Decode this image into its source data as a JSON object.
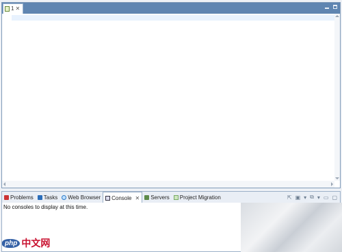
{
  "editor": {
    "tab_title": "1",
    "tab_close": "✕",
    "minimize_glyph": "",
    "maximize_glyph": ""
  },
  "views": {
    "tabs": [
      {
        "label": "Problems",
        "icon": "problems-icon"
      },
      {
        "label": "Tasks",
        "icon": "tasks-icon"
      },
      {
        "label": "Web Browser",
        "icon": "web-browser-icon"
      },
      {
        "label": "Console",
        "icon": "console-icon",
        "active": true,
        "close": "✕"
      },
      {
        "label": "Servers",
        "icon": "servers-icon"
      },
      {
        "label": "Project Migration",
        "icon": "project-migration-icon"
      }
    ],
    "tools": [
      "⇱",
      "▣",
      "▾",
      "⧉",
      "▾",
      "▭",
      "▢"
    ],
    "message": "No consoles to display at this time."
  },
  "watermark": {
    "badge": "php",
    "text": "中文网"
  },
  "colors": {
    "titlebar": "#5f85b1",
    "current_line": "#e8f2fe",
    "views_bar": "#e9eef5"
  }
}
